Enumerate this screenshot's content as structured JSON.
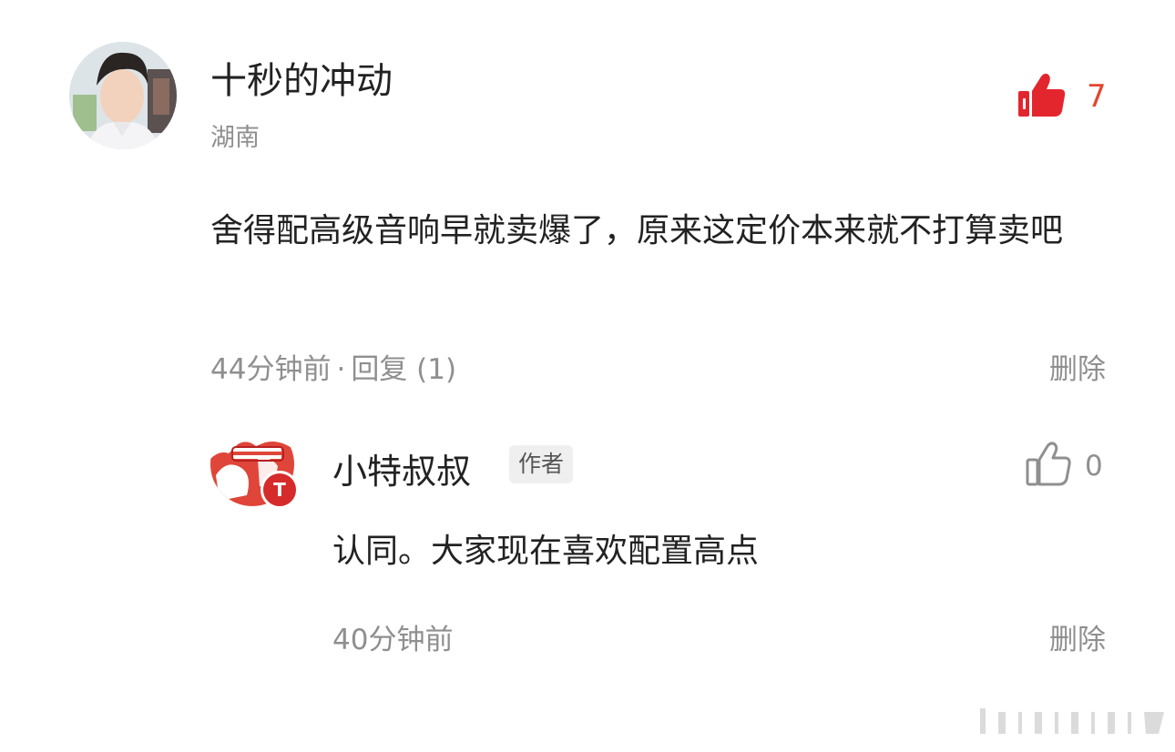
{
  "main_comment": {
    "user_name": "十秒的冲动",
    "location": "湖南",
    "like_count": "7",
    "content": "舍得配高级音响早就卖爆了，原来这定价本来就不打算卖吧",
    "time": "44分钟前",
    "separator": "·",
    "reply_label": "回复 (1)",
    "delete_label": "删除",
    "colors": {
      "like_active": "#e3452f",
      "meta_gray": "#8f8f8f"
    }
  },
  "reply": {
    "user_name": "小特叔叔",
    "author_tag": "作者",
    "like_count": "0",
    "content": "认同。大家现在喜欢配置高点",
    "time": "40分钟前",
    "delete_label": "删除",
    "badge_letter": "T"
  },
  "icons": {
    "like_filled": "thumbs-up-filled-icon",
    "like_outline": "thumbs-up-outline-icon"
  }
}
